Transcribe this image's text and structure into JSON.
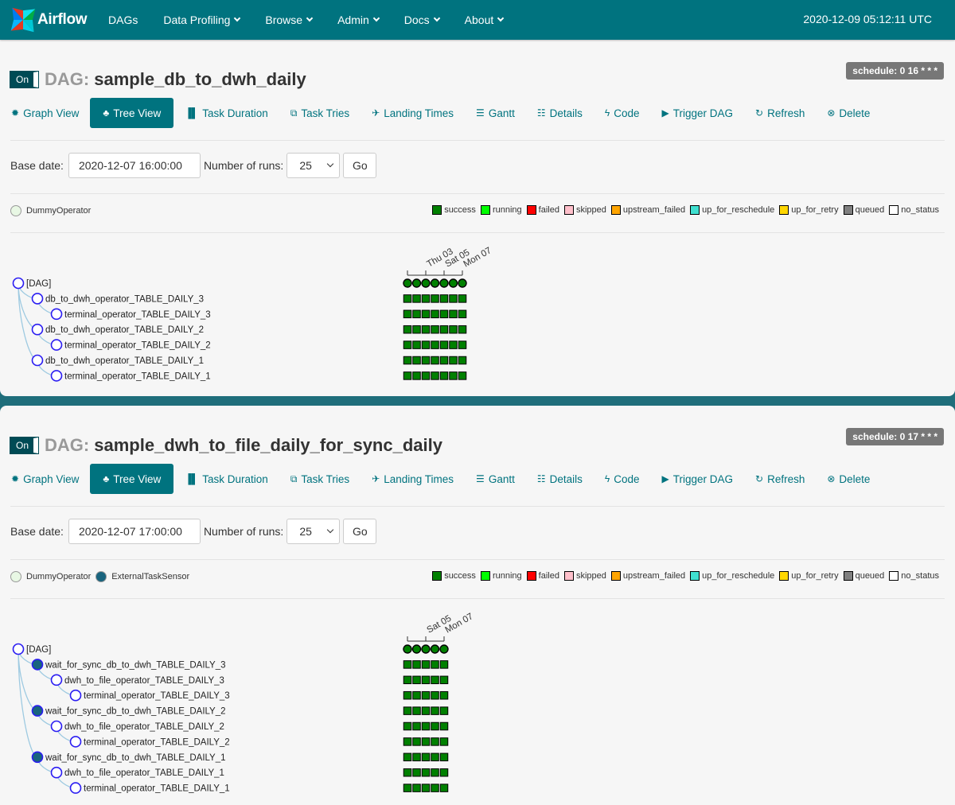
{
  "nav": {
    "brand": "Airflow",
    "items": [
      {
        "label": "DAGs",
        "dropdown": false
      },
      {
        "label": "Data Profiling",
        "dropdown": true
      },
      {
        "label": "Browse",
        "dropdown": true
      },
      {
        "label": "Admin",
        "dropdown": true
      },
      {
        "label": "Docs",
        "dropdown": true
      },
      {
        "label": "About",
        "dropdown": true
      }
    ],
    "clock": "2020-12-09 05:12:11 UTC"
  },
  "colors": {
    "primary": "#00737f",
    "success": "#008000",
    "running": "#00ff00",
    "failed": "#ff0000",
    "skipped": "#ffc0cb",
    "upstream_failed": "#ffa500",
    "up_for_reschedule": "#40e0d0",
    "up_for_retry": "#ffd700",
    "queued": "#808080",
    "no_status": "#ffffff",
    "dummy_operator": "#e8f7e4",
    "external_sensor": "#19647e"
  },
  "state_legend": [
    {
      "label": "success",
      "color": "#008000"
    },
    {
      "label": "running",
      "color": "#00ff00"
    },
    {
      "label": "failed",
      "color": "#ff0000"
    },
    {
      "label": "skipped",
      "color": "#ffc0cb"
    },
    {
      "label": "upstream_failed",
      "color": "#ffa500"
    },
    {
      "label": "up_for_reschedule",
      "color": "#40e0d0"
    },
    {
      "label": "up_for_retry",
      "color": "#ffd700"
    },
    {
      "label": "queued",
      "color": "#808080"
    },
    {
      "label": "no_status",
      "color": "#ffffff"
    }
  ],
  "tabs": [
    {
      "label": "Graph View",
      "icon": "asterisk-icon",
      "glyph": "✹"
    },
    {
      "label": "Tree View",
      "icon": "tree-icon",
      "glyph": "♣",
      "active": true
    },
    {
      "label": "Task Duration",
      "icon": "bar-chart-icon",
      "glyph": "▐▌"
    },
    {
      "label": "Task Tries",
      "icon": "duplicate-icon",
      "glyph": "⧉"
    },
    {
      "label": "Landing Times",
      "icon": "plane-icon",
      "glyph": "✈"
    },
    {
      "label": "Gantt",
      "icon": "align-left-icon",
      "glyph": "☰"
    },
    {
      "label": "Details",
      "icon": "list-icon",
      "glyph": "☷"
    },
    {
      "label": "Code",
      "icon": "flash-icon",
      "glyph": "ϟ"
    },
    {
      "label": "Trigger DAG",
      "icon": "play-circle-icon",
      "glyph": "▶"
    },
    {
      "label": "Refresh",
      "icon": "refresh-icon",
      "glyph": "↻"
    },
    {
      "label": "Delete",
      "icon": "remove-circle-icon",
      "glyph": "⊗"
    }
  ],
  "form_labels": {
    "base_date": "Base date:",
    "num_runs": "Number of runs:",
    "go": "Go"
  },
  "dags": [
    {
      "toggle": "On",
      "prefix": "DAG:",
      "name": "sample_db_to_dwh_daily",
      "schedule": "schedule: 0 16 * * *",
      "base_date": "2020-12-07 16:00:00",
      "num_runs": "25",
      "operators": [
        {
          "label": "DummyOperator",
          "color": "#e8f7e4"
        }
      ],
      "date_labels": [
        "Thu 03",
        "Sat 05",
        "Mon 07"
      ],
      "run_count": 7,
      "tasks": [
        {
          "label": "[DAG]",
          "depth": 0,
          "kind": "dag"
        },
        {
          "label": "db_to_dwh_operator_TABLE_DAILY_3",
          "depth": 1,
          "kind": "dummy"
        },
        {
          "label": "terminal_operator_TABLE_DAILY_3",
          "depth": 2,
          "kind": "dummy"
        },
        {
          "label": "db_to_dwh_operator_TABLE_DAILY_2",
          "depth": 1,
          "kind": "dummy"
        },
        {
          "label": "terminal_operator_TABLE_DAILY_2",
          "depth": 2,
          "kind": "dummy"
        },
        {
          "label": "db_to_dwh_operator_TABLE_DAILY_1",
          "depth": 1,
          "kind": "dummy"
        },
        {
          "label": "terminal_operator_TABLE_DAILY_1",
          "depth": 2,
          "kind": "dummy"
        }
      ]
    },
    {
      "toggle": "On",
      "prefix": "DAG:",
      "name": "sample_dwh_to_file_daily_for_sync_daily",
      "schedule": "schedule: 0 17 * * *",
      "base_date": "2020-12-07 17:00:00",
      "num_runs": "25",
      "operators": [
        {
          "label": "DummyOperator",
          "color": "#e8f7e4"
        },
        {
          "label": "ExternalTaskSensor",
          "color": "#19647e"
        }
      ],
      "date_labels": [
        "Sat 05",
        "Mon 07"
      ],
      "run_count": 5,
      "tasks": [
        {
          "label": "[DAG]",
          "depth": 0,
          "kind": "dag"
        },
        {
          "label": "wait_for_sync_db_to_dwh_TABLE_DAILY_3",
          "depth": 1,
          "kind": "sensor"
        },
        {
          "label": "dwh_to_file_operator_TABLE_DAILY_3",
          "depth": 2,
          "kind": "dummy"
        },
        {
          "label": "terminal_operator_TABLE_DAILY_3",
          "depth": 3,
          "kind": "dummy"
        },
        {
          "label": "wait_for_sync_db_to_dwh_TABLE_DAILY_2",
          "depth": 1,
          "kind": "sensor"
        },
        {
          "label": "dwh_to_file_operator_TABLE_DAILY_2",
          "depth": 2,
          "kind": "dummy"
        },
        {
          "label": "terminal_operator_TABLE_DAILY_2",
          "depth": 3,
          "kind": "dummy"
        },
        {
          "label": "wait_for_sync_db_to_dwh_TABLE_DAILY_1",
          "depth": 1,
          "kind": "sensor"
        },
        {
          "label": "dwh_to_file_operator_TABLE_DAILY_1",
          "depth": 2,
          "kind": "dummy"
        },
        {
          "label": "terminal_operator_TABLE_DAILY_1",
          "depth": 3,
          "kind": "dummy"
        }
      ]
    }
  ]
}
